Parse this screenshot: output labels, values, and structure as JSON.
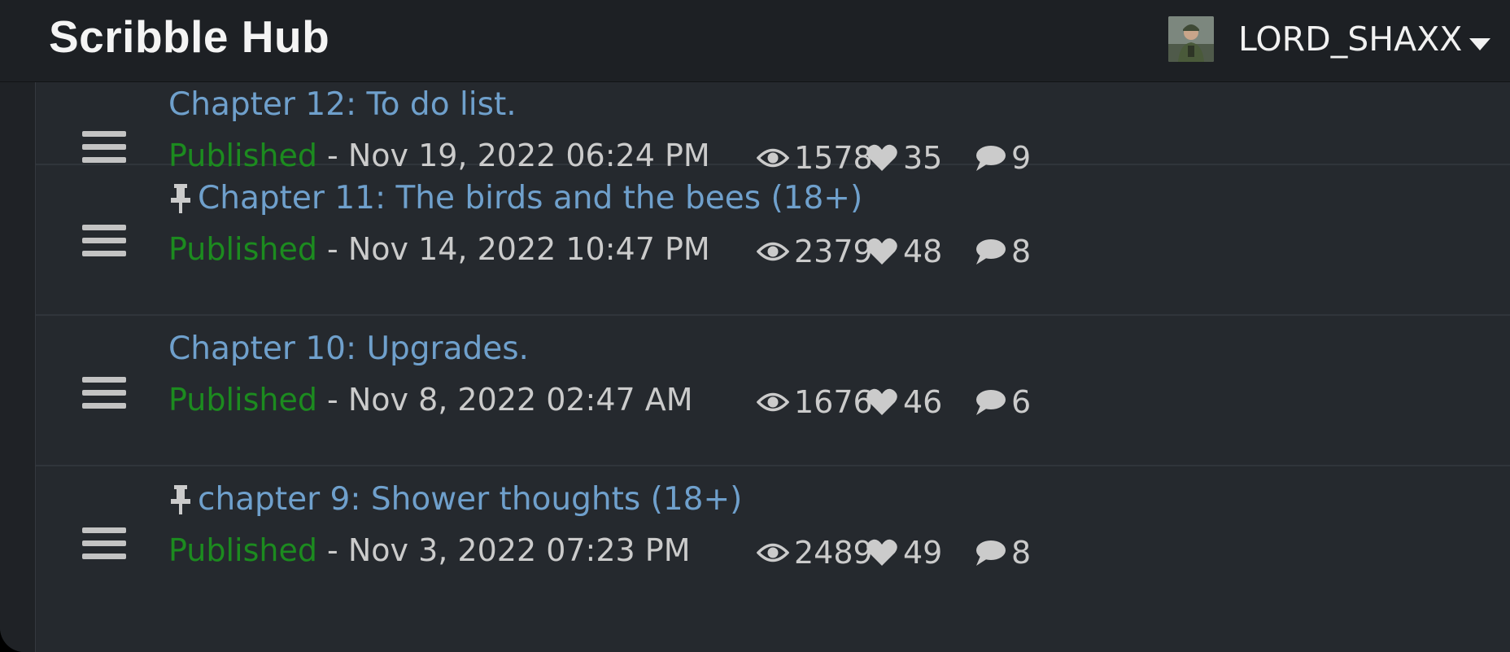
{
  "header": {
    "brand": "Scribble Hub",
    "username": "LORD_SHAXX"
  },
  "colors": {
    "title_link": "#6fa0cc",
    "published": "#1c8b1f",
    "meta_text": "#cbcbcb",
    "background": "#25292e"
  },
  "chapters": [
    {
      "title": "Chapter 12: To do list.",
      "pinned": false,
      "status": "Published",
      "date": "- Nov 19, 2022 06:24 PM",
      "views": "1578",
      "likes": "35",
      "comments": "9"
    },
    {
      "title": "Chapter 11: The birds and the bees (18+)",
      "pinned": true,
      "status": "Published",
      "date": "- Nov 14, 2022 10:47 PM",
      "views": "2379",
      "likes": "48",
      "comments": "8"
    },
    {
      "title": "Chapter 10: Upgrades.",
      "pinned": false,
      "status": "Published",
      "date": "- Nov 8, 2022 02:47 AM",
      "views": "1676",
      "likes": "46",
      "comments": "6"
    },
    {
      "title": "chapter 9: Shower thoughts (18+)",
      "pinned": true,
      "status": "Published",
      "date": "- Nov 3, 2022 07:23 PM",
      "views": "2489",
      "likes": "49",
      "comments": "8"
    }
  ]
}
